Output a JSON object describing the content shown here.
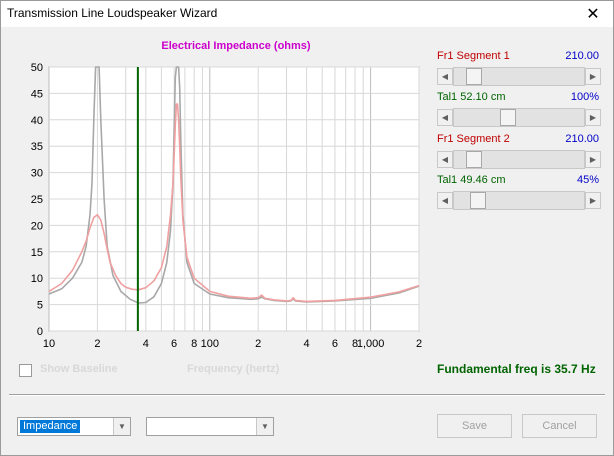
{
  "window": {
    "title": "Transmission Line Loudspeaker Wizard",
    "close_glyph": "✕"
  },
  "graph": {
    "title": "Electrical Impedance (ohms)",
    "x_label": "Frequency (hertz)",
    "show_baseline_label": "Show Baseline",
    "fundamental_text": "Fundamental freq is 35.7 Hz"
  },
  "chart_data": {
    "type": "line",
    "title": "Electrical Impedance (ohms)",
    "xlabel": "Frequency (hertz)",
    "ylabel": "",
    "xscale": "log",
    "xlim": [
      10,
      2000
    ],
    "ylim": [
      0,
      50
    ],
    "y_ticks": [
      0,
      5,
      10,
      15,
      20,
      25,
      30,
      35,
      40,
      45,
      50
    ],
    "y_tick_labels": [
      "0",
      "5",
      "10",
      "15",
      "20",
      "25",
      "30",
      "35",
      "40",
      "45",
      "50"
    ],
    "x_ticks": [
      10,
      20,
      40,
      60,
      80,
      100,
      200,
      400,
      600,
      800,
      1000,
      2000
    ],
    "x_tick_labels": [
      "10",
      "2",
      "4",
      "6",
      "8",
      "100",
      "2",
      "4",
      "6",
      "8",
      "1,000",
      "2"
    ],
    "grid": true,
    "marker_line": {
      "x": 35.7,
      "color": "#006400"
    },
    "series": [
      {
        "color": "#a8a8a8",
        "x": [
          10,
          12,
          14,
          16,
          17,
          18,
          18.5,
          19,
          19.5,
          20,
          20.5,
          21,
          22,
          23,
          25,
          28,
          32,
          36,
          40,
          45,
          50,
          54,
          57,
          59,
          60,
          61,
          62,
          63,
          64,
          65,
          66,
          68,
          72,
          80,
          100,
          130,
          180,
          200,
          210,
          220,
          250,
          300,
          320,
          330,
          340,
          400,
          600,
          1000,
          1500,
          2000
        ],
        "y": [
          7,
          8,
          10,
          13,
          16,
          22,
          28,
          40,
          50,
          50,
          50,
          40,
          25,
          16,
          10.5,
          7.5,
          6,
          5.3,
          5.4,
          6.5,
          9,
          13,
          19,
          28,
          38,
          48,
          50,
          50,
          50,
          46,
          36,
          22,
          13,
          9,
          7,
          6.3,
          6,
          6.1,
          6.4,
          6.1,
          5.8,
          5.6,
          5.7,
          6.1,
          5.7,
          5.5,
          5.7,
          6.2,
          7.2,
          8.5
        ]
      },
      {
        "color": "#f0a0a0",
        "x": [
          10,
          12,
          14,
          16,
          17,
          18,
          19,
          20,
          21,
          22,
          23,
          24,
          26,
          28,
          30,
          33,
          36,
          40,
          45,
          50,
          54,
          57,
          59,
          60,
          61,
          62,
          63,
          64,
          65,
          66,
          68,
          72,
          80,
          100,
          130,
          180,
          200,
          210,
          220,
          250,
          300,
          320,
          330,
          340,
          400,
          600,
          1000,
          1500,
          2000
        ],
        "y": [
          7.5,
          9,
          11.5,
          15,
          17,
          19.5,
          21.5,
          22,
          21,
          18.5,
          15.5,
          13,
          10.5,
          9,
          8.3,
          7.9,
          7.8,
          8.2,
          9.5,
          12,
          16,
          22,
          28,
          33,
          39,
          43,
          43,
          40,
          35,
          29,
          21,
          14,
          10,
          7.5,
          6.6,
          6.2,
          6.3,
          6.8,
          6.2,
          5.9,
          5.7,
          5.8,
          6.3,
          5.8,
          5.6,
          5.8,
          6.4,
          7.4,
          8.6
        ]
      }
    ]
  },
  "controls": {
    "seg1": {
      "label": "Fr1  Segment 1",
      "value": "210.00"
    },
    "tal1a": {
      "label": "Tal1  52.10 cm",
      "value": "100%"
    },
    "seg2": {
      "label": "Fr1  Segment 2",
      "value": "210.00"
    },
    "tal1b": {
      "label": "Tal1  49.46 cm",
      "value": "45%"
    }
  },
  "bottom": {
    "view_select": {
      "selected": "Impedance"
    },
    "second_select": {
      "selected": ""
    },
    "save_label": "Save",
    "cancel_label": "Cancel"
  }
}
